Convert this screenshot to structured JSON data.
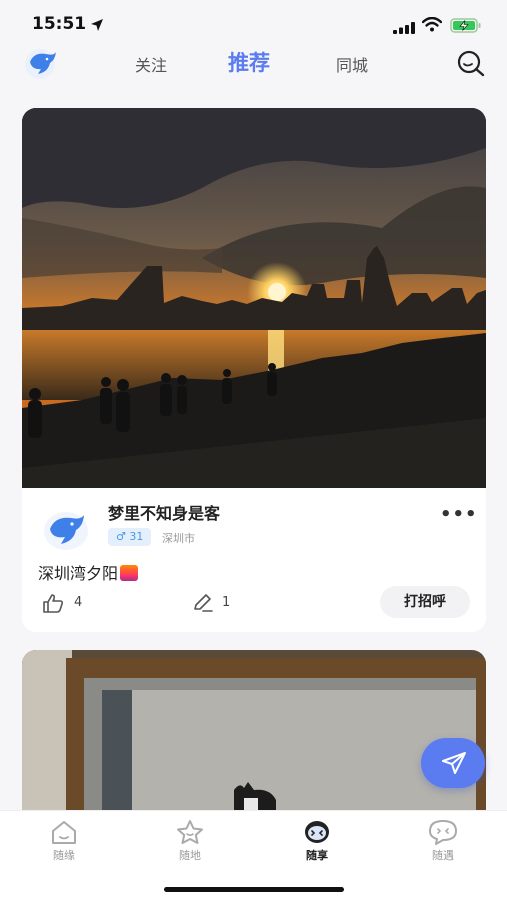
{
  "status_bar": {
    "time": "15:51",
    "icons": [
      "location-arrow-icon",
      "cellular-signal-icon",
      "wifi-icon",
      "battery-charging-icon"
    ]
  },
  "top_nav": {
    "logo": "bird-logo",
    "tabs": [
      {
        "label": "关注",
        "active": false
      },
      {
        "label": "推荐",
        "active": true
      },
      {
        "label": "同城",
        "active": false
      }
    ],
    "search_icon": "search-icon",
    "accent_color": "#5b7cf0"
  },
  "posts": [
    {
      "photo": "sunset-over-bay-with-city-skyline",
      "username": "梦里不知身是客",
      "gender": "♂",
      "age": "31",
      "city": "深圳市",
      "text": "深圳湾夕阳",
      "likes": "4",
      "comments": "1",
      "greet_label": "打招呼",
      "more_icon": "more-dots-icon"
    },
    {
      "photo": "room-with-doorway-and-figure"
    }
  ],
  "fab": {
    "icon": "send-icon"
  },
  "bottom_tabs": [
    {
      "label": "随缘",
      "icon": "house-icon",
      "active": false
    },
    {
      "label": "随地",
      "icon": "star-icon",
      "active": false
    },
    {
      "label": "随享",
      "icon": "face-icon",
      "active": true
    },
    {
      "label": "随遇",
      "icon": "chat-bubble-icon",
      "active": false
    }
  ]
}
